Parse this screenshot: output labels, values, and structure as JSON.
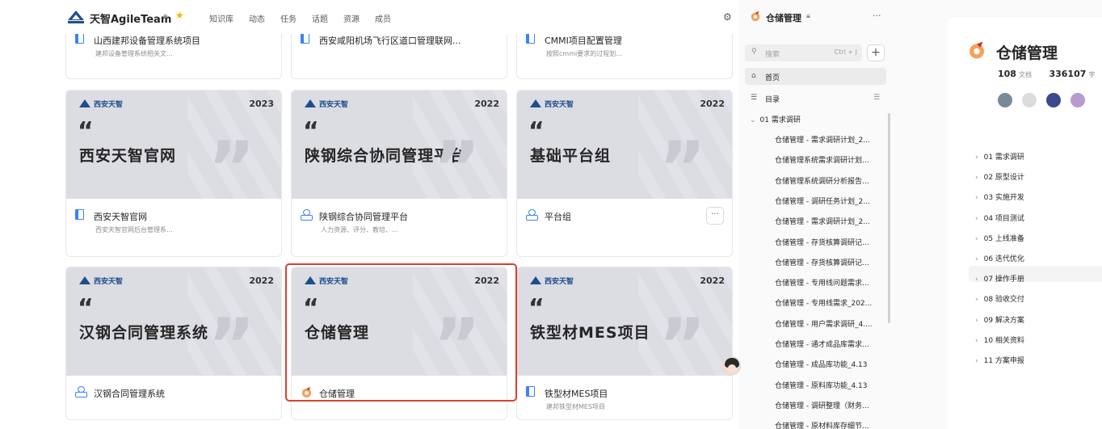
{
  "header": {
    "team_name": "天智AgileTeam",
    "nav": [
      "知识库",
      "动态",
      "任务",
      "话题",
      "资源",
      "成员"
    ]
  },
  "top_cards": [
    {
      "name": "山西建邦设备管理系统项目",
      "desc": "建邦设备管理系统相关文...",
      "icon": "book-icon"
    },
    {
      "name": "西安咸阳机场飞行区道口管理联网...",
      "desc": "",
      "icon": "book-icon"
    },
    {
      "name": "CMMI项目配置管理",
      "desc": "按照cmmi要求的过程划...",
      "icon": "book-icon"
    }
  ],
  "cards": [
    {
      "cover_brand": "西安天智",
      "year": "2023",
      "cover_title": "西安天智官网",
      "name": "西安天智官网",
      "desc": "西安天智官网后台管理系...",
      "icon": "book-icon"
    },
    {
      "cover_brand": "西安天智",
      "year": "2022",
      "cover_title": "陕钢综合协同管理平台",
      "name": "陕钢综合协同管理平台",
      "desc": "人力资源、评分、教培、...",
      "icon": "group-icon"
    },
    {
      "cover_brand": "西安天智",
      "year": "2022",
      "cover_title": "基础平台组",
      "name": "平台组",
      "desc": "",
      "icon": "group-icon",
      "menu": "···"
    },
    {
      "cover_brand": "西安天智",
      "year": "2022",
      "cover_title": "汉钢合同管理系统",
      "name": "汉钢合同管理系统",
      "desc": "",
      "icon": "group-icon"
    },
    {
      "cover_brand": "西安天智",
      "year": "2022",
      "cover_title": "仓储管理",
      "name": "仓储管理",
      "desc": "",
      "icon": "warehouse-icon"
    },
    {
      "cover_brand": "西安天智",
      "year": "2022",
      "cover_title": "铁型材MES项目",
      "name": "铁型材MES项目",
      "desc": "建邦铁型材MES项目",
      "icon": "book-icon"
    }
  ],
  "sidebar": {
    "title": "仓储管理",
    "more": "···",
    "search_placeholder": "搜索",
    "search_shortcut": "Ctrl + J",
    "add": "+",
    "home": "首页",
    "toc": "目录",
    "group": "01 需求调研",
    "docs": [
      "仓储管理 - 需求调研计划_2...",
      "仓储管理系统需求调研计划...",
      "仓储管理系统调研分析报告...",
      "仓储管理 - 调研任务计划_2...",
      "仓储管理 - 需求调研计划_2...",
      "仓储管理 - 存货核算调研记...",
      "仓储管理 - 存货核算调研记...",
      "仓储管理 - 专用线问题需求...",
      "仓储管理 - 专用线需求_202...",
      "仓储管理 - 用户需求调研_4....",
      "仓储管理 - 通才成品库需求...",
      "仓储管理 - 成品库功能_4.13",
      "仓储管理 - 原料库功能_4.13",
      "仓储管理 - 调研整理（财务...",
      "仓储管理 - 原材料库存细节..."
    ]
  },
  "right_panel": {
    "title": "仓储管理",
    "doc_count": "108",
    "doc_label": "文档",
    "word_count": "336107",
    "word_label": "字",
    "items": [
      "01 需求调研",
      "02 原型设计",
      "03 实施开发",
      "04 项目测试",
      "05 上线准备",
      "06 迭代优化",
      "07 操作手册",
      "08 验收交付",
      "09 解决方案",
      "10 相关资料",
      "11 方案申报"
    ]
  },
  "colors": {
    "accent": "#3b82f6",
    "highlight": "#d9412e",
    "brand": "#1f4e8c"
  }
}
